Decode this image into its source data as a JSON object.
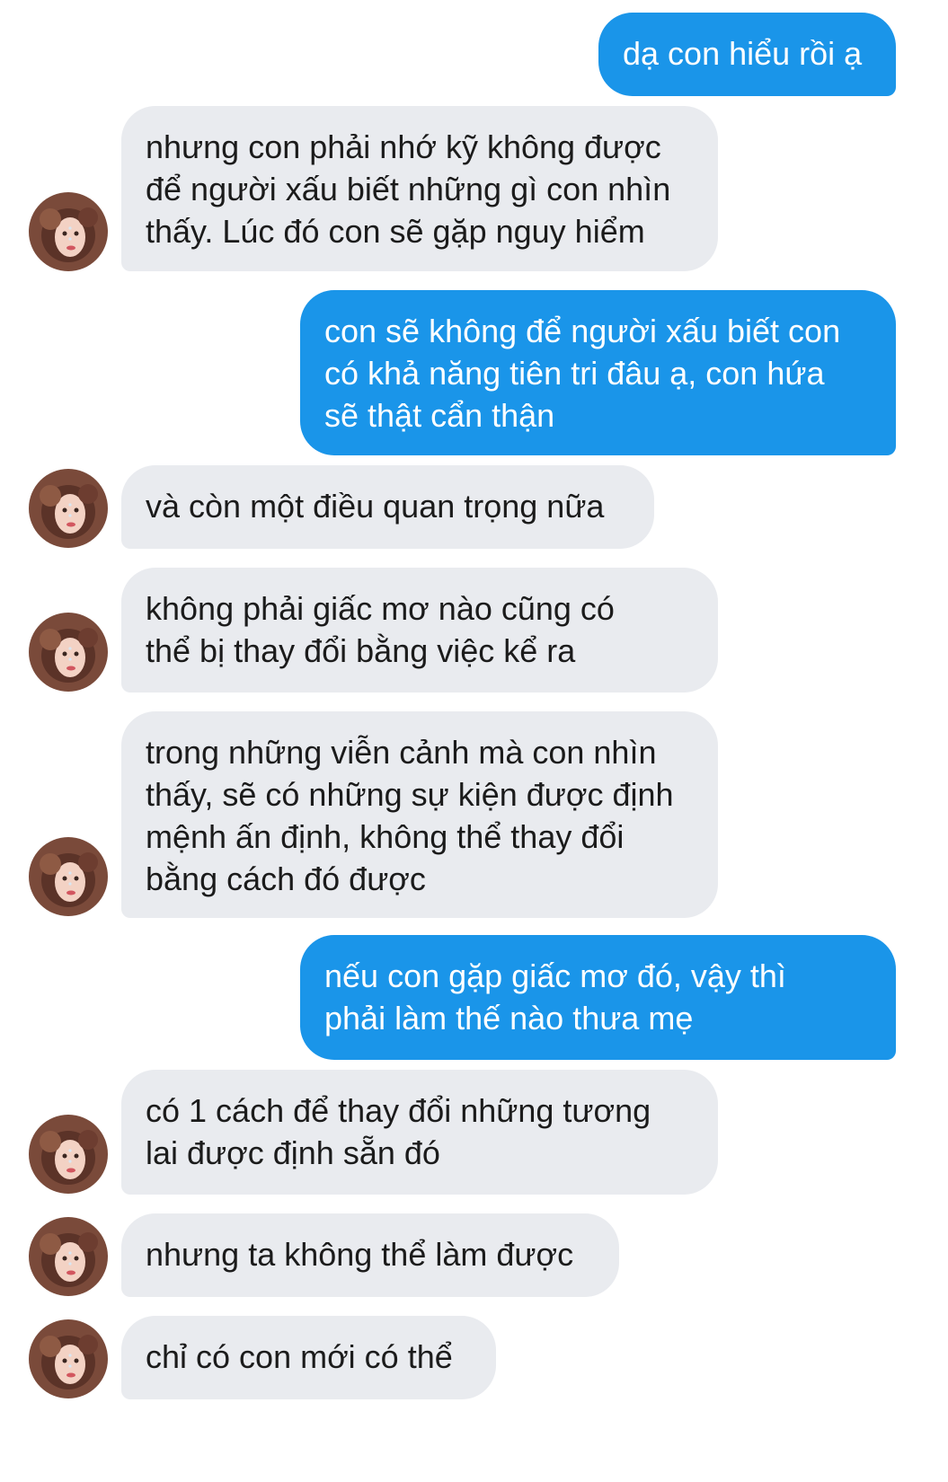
{
  "conversation": {
    "messages": [
      {
        "sender": "me",
        "text": "dạ con hiểu rồi ạ"
      },
      {
        "sender": "mother",
        "text": "nhưng con phải nhớ kỹ không được\nđể người xấu biết những gì con nhìn\nthấy. Lúc đó con sẽ gặp nguy hiểm"
      },
      {
        "sender": "me",
        "text": "con sẽ không để người xấu biết con\ncó khả năng tiên tri đâu ạ, con hứa\nsẽ thật cẩn thận"
      },
      {
        "sender": "mother",
        "text": "và còn một điều quan trọng nữa"
      },
      {
        "sender": "mother",
        "text": "không phải giấc mơ nào cũng có\nthể bị thay đổi bằng việc kể ra"
      },
      {
        "sender": "mother",
        "text": "trong những viễn cảnh mà con nhìn\nthấy, sẽ có những sự kiện được định\nmệnh ấn định, không thể thay đổi\nbằng cách đó được"
      },
      {
        "sender": "me",
        "text": "nếu con gặp giấc mơ đó, vậy thì\nphải làm thế nào thưa mẹ"
      },
      {
        "sender": "mother",
        "text": "có 1 cách để thay đổi những tương\nlai được định sẵn đó"
      },
      {
        "sender": "mother",
        "text": "nhưng ta không thể làm được"
      },
      {
        "sender": "mother",
        "text": "chỉ có con mới có thể"
      }
    ]
  },
  "colors": {
    "outgoing_bubble": "#1a95e9",
    "incoming_bubble": "#e9ebef",
    "background": "#ffffff"
  },
  "icons": {
    "avatar": "contact-avatar-photo"
  }
}
